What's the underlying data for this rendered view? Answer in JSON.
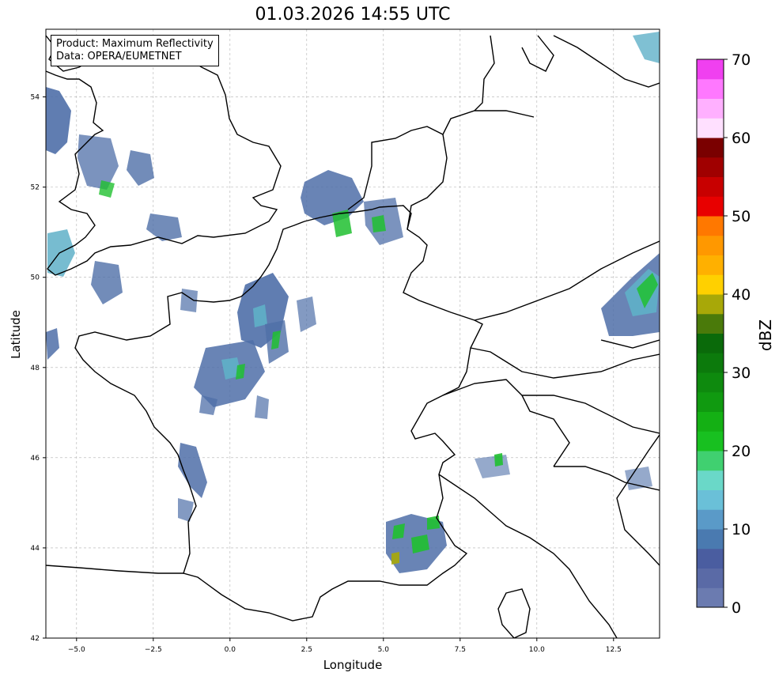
{
  "title": "01.03.2026 14:55 UTC",
  "info_box": {
    "line1": "Product: Maximum Reflectivity",
    "line2": "Data: OPERA/EUMETNET"
  },
  "axes": {
    "xlabel": "Longitude",
    "ylabel": "Latitude",
    "xlim": [
      -6,
      14
    ],
    "ylim": [
      42,
      55.5
    ],
    "xticks": [
      -5.0,
      -2.5,
      0.0,
      2.5,
      5.0,
      7.5,
      10.0,
      12.5
    ],
    "xtick_labels": [
      "−5.0",
      "−2.5",
      "0.0",
      "2.5",
      "5.0",
      "7.5",
      "10.0",
      "12.5"
    ],
    "yticks": [
      42,
      44,
      46,
      48,
      50,
      52,
      54
    ],
    "ytick_labels": [
      "42",
      "44",
      "46",
      "48",
      "50",
      "52",
      "54"
    ],
    "grid": true
  },
  "colorbar": {
    "label": "dBZ",
    "min": 0,
    "max": 70,
    "step": 2.5,
    "tick_values": [
      0,
      10,
      20,
      30,
      40,
      50,
      60,
      70
    ],
    "tick_labels": [
      "0",
      "10",
      "20",
      "30",
      "40",
      "50",
      "60",
      "70"
    ],
    "colors": [
      "#6b7bb0",
      "#5a6aa6",
      "#4a5da0",
      "#4a7ab0",
      "#5a9ac8",
      "#6ac0d8",
      "#6ad8c8",
      "#40d070",
      "#18c020",
      "#14b014",
      "#109a10",
      "#0e8a0e",
      "#0c7a0c",
      "#0a6a0a",
      "#4a7a0a",
      "#a8a808",
      "#ffd000",
      "#ffb000",
      "#ff9800",
      "#ff7800",
      "#e80000",
      "#c80000",
      "#a00000",
      "#7a0000",
      "#ffe0ff",
      "#ffb0ff",
      "#ff78ff",
      "#f040f0"
    ]
  },
  "colors": {
    "coastline": "#000000",
    "grid": "#b0b0b0",
    "echo_light": "#4f6fa8",
    "echo_mid": "#5fb0c8",
    "echo_green": "#20c030"
  }
}
